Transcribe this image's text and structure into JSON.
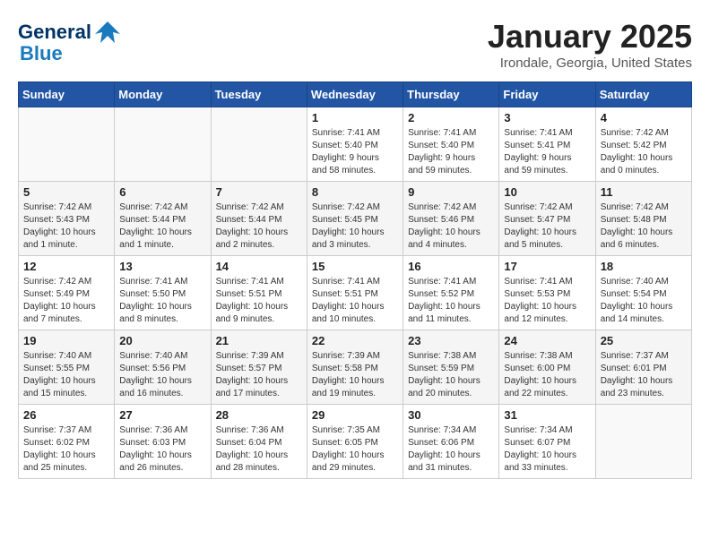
{
  "header": {
    "logo_general": "General",
    "logo_blue": "Blue",
    "month": "January 2025",
    "location": "Irondale, Georgia, United States"
  },
  "weekdays": [
    "Sunday",
    "Monday",
    "Tuesday",
    "Wednesday",
    "Thursday",
    "Friday",
    "Saturday"
  ],
  "weeks": [
    [
      {
        "day": "",
        "info": ""
      },
      {
        "day": "",
        "info": ""
      },
      {
        "day": "",
        "info": ""
      },
      {
        "day": "1",
        "info": "Sunrise: 7:41 AM\nSunset: 5:40 PM\nDaylight: 9 hours\nand 58 minutes."
      },
      {
        "day": "2",
        "info": "Sunrise: 7:41 AM\nSunset: 5:40 PM\nDaylight: 9 hours\nand 59 minutes."
      },
      {
        "day": "3",
        "info": "Sunrise: 7:41 AM\nSunset: 5:41 PM\nDaylight: 9 hours\nand 59 minutes."
      },
      {
        "day": "4",
        "info": "Sunrise: 7:42 AM\nSunset: 5:42 PM\nDaylight: 10 hours\nand 0 minutes."
      }
    ],
    [
      {
        "day": "5",
        "info": "Sunrise: 7:42 AM\nSunset: 5:43 PM\nDaylight: 10 hours\nand 1 minute."
      },
      {
        "day": "6",
        "info": "Sunrise: 7:42 AM\nSunset: 5:44 PM\nDaylight: 10 hours\nand 1 minute."
      },
      {
        "day": "7",
        "info": "Sunrise: 7:42 AM\nSunset: 5:44 PM\nDaylight: 10 hours\nand 2 minutes."
      },
      {
        "day": "8",
        "info": "Sunrise: 7:42 AM\nSunset: 5:45 PM\nDaylight: 10 hours\nand 3 minutes."
      },
      {
        "day": "9",
        "info": "Sunrise: 7:42 AM\nSunset: 5:46 PM\nDaylight: 10 hours\nand 4 minutes."
      },
      {
        "day": "10",
        "info": "Sunrise: 7:42 AM\nSunset: 5:47 PM\nDaylight: 10 hours\nand 5 minutes."
      },
      {
        "day": "11",
        "info": "Sunrise: 7:42 AM\nSunset: 5:48 PM\nDaylight: 10 hours\nand 6 minutes."
      }
    ],
    [
      {
        "day": "12",
        "info": "Sunrise: 7:42 AM\nSunset: 5:49 PM\nDaylight: 10 hours\nand 7 minutes."
      },
      {
        "day": "13",
        "info": "Sunrise: 7:41 AM\nSunset: 5:50 PM\nDaylight: 10 hours\nand 8 minutes."
      },
      {
        "day": "14",
        "info": "Sunrise: 7:41 AM\nSunset: 5:51 PM\nDaylight: 10 hours\nand 9 minutes."
      },
      {
        "day": "15",
        "info": "Sunrise: 7:41 AM\nSunset: 5:51 PM\nDaylight: 10 hours\nand 10 minutes."
      },
      {
        "day": "16",
        "info": "Sunrise: 7:41 AM\nSunset: 5:52 PM\nDaylight: 10 hours\nand 11 minutes."
      },
      {
        "day": "17",
        "info": "Sunrise: 7:41 AM\nSunset: 5:53 PM\nDaylight: 10 hours\nand 12 minutes."
      },
      {
        "day": "18",
        "info": "Sunrise: 7:40 AM\nSunset: 5:54 PM\nDaylight: 10 hours\nand 14 minutes."
      }
    ],
    [
      {
        "day": "19",
        "info": "Sunrise: 7:40 AM\nSunset: 5:55 PM\nDaylight: 10 hours\nand 15 minutes."
      },
      {
        "day": "20",
        "info": "Sunrise: 7:40 AM\nSunset: 5:56 PM\nDaylight: 10 hours\nand 16 minutes."
      },
      {
        "day": "21",
        "info": "Sunrise: 7:39 AM\nSunset: 5:57 PM\nDaylight: 10 hours\nand 17 minutes."
      },
      {
        "day": "22",
        "info": "Sunrise: 7:39 AM\nSunset: 5:58 PM\nDaylight: 10 hours\nand 19 minutes."
      },
      {
        "day": "23",
        "info": "Sunrise: 7:38 AM\nSunset: 5:59 PM\nDaylight: 10 hours\nand 20 minutes."
      },
      {
        "day": "24",
        "info": "Sunrise: 7:38 AM\nSunset: 6:00 PM\nDaylight: 10 hours\nand 22 minutes."
      },
      {
        "day": "25",
        "info": "Sunrise: 7:37 AM\nSunset: 6:01 PM\nDaylight: 10 hours\nand 23 minutes."
      }
    ],
    [
      {
        "day": "26",
        "info": "Sunrise: 7:37 AM\nSunset: 6:02 PM\nDaylight: 10 hours\nand 25 minutes."
      },
      {
        "day": "27",
        "info": "Sunrise: 7:36 AM\nSunset: 6:03 PM\nDaylight: 10 hours\nand 26 minutes."
      },
      {
        "day": "28",
        "info": "Sunrise: 7:36 AM\nSunset: 6:04 PM\nDaylight: 10 hours\nand 28 minutes."
      },
      {
        "day": "29",
        "info": "Sunrise: 7:35 AM\nSunset: 6:05 PM\nDaylight: 10 hours\nand 29 minutes."
      },
      {
        "day": "30",
        "info": "Sunrise: 7:34 AM\nSunset: 6:06 PM\nDaylight: 10 hours\nand 31 minutes."
      },
      {
        "day": "31",
        "info": "Sunrise: 7:34 AM\nSunset: 6:07 PM\nDaylight: 10 hours\nand 33 minutes."
      },
      {
        "day": "",
        "info": ""
      }
    ]
  ]
}
